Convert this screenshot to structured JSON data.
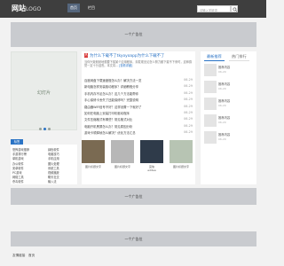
{
  "header": {
    "logo_main": "网站",
    "logo_sub": "LOGO",
    "nav": [
      {
        "label": "首页",
        "active": true
      },
      {
        "label": "栏目",
        "active": false
      }
    ],
    "search_placeholder": "请输入关键词"
  },
  "ads": {
    "top": "一个广告位",
    "middle": "一个广告位",
    "bottom": "一个广告位"
  },
  "slideshow": {
    "label": "幻灯片",
    "total": 3,
    "active_index": 1
  },
  "news": {
    "badge": "热",
    "headline": "为什么下载不了tkyoyoapp为什么下载不了",
    "summary": "当你兴致勃勃地想要下载某个应用程序，却发现无论怎么努力都下载不下来时，这种感觉一定十分沮丧。本文将...",
    "summary_more": "[查看详细]",
    "items": [
      {
        "title": "百度网盘下载速度慢怎么办？解决方法一览",
        "date": "06-29"
      },
      {
        "title": "新电脑怎样安装驱动程序？详细教程分享",
        "date": "06-29"
      },
      {
        "title": "手机内存不足怎么办？这几个方法能帮你",
        "date": "06-29"
      },
      {
        "title": "手心保修卡丢失了还能保修吗？完整说明",
        "date": "06-29"
      },
      {
        "title": "路由器WiFi信号不好？这样设置一下就好了",
        "date": "06-29"
      },
      {
        "title": "如何在电脑上安装打印机驱动程序",
        "date": "06-29"
      },
      {
        "title": "文件压缩格式有哪些？常见格式对比",
        "date": "06-29"
      },
      {
        "title": "电脑开机黑屏怎么办？常见原因分析",
        "date": "06-29"
      },
      {
        "title": "游戏卡顿掉帧怎么解决？优化方法汇总",
        "date": "06-29"
      }
    ]
  },
  "side": {
    "tabs": [
      "最新推荐",
      "热门排行"
    ],
    "items": [
      {
        "title": "推荐内容",
        "meta": "06-29"
      },
      {
        "title": "推荐内容",
        "meta": "06-29"
      },
      {
        "title": "推荐内容",
        "meta": "06-29"
      },
      {
        "title": "推荐内容",
        "meta": "06-29"
      },
      {
        "title": "推荐内容",
        "meta": "06-29"
      }
    ]
  },
  "tags": {
    "label": "标签",
    "rows": [
      [
        "恐怖游戏推荐",
        "绿色软件"
      ],
      [
        "手游排行榜",
        "电脑技巧"
      ],
      [
        "单机游戏",
        "手机应用"
      ],
      [
        "办公软件",
        "图片处理"
      ],
      [
        "安卓软件",
        "系统工具"
      ],
      [
        "PC游戏",
        "视频播放"
      ],
      [
        "网络工具",
        "聊天社交"
      ],
      [
        "杀毒软件",
        "输入法"
      ]
    ]
  },
  "tiles": [
    {
      "caption": "图片标题文字",
      "caption2": "",
      "color": "#7a6a52"
    },
    {
      "caption": "图片标题文字",
      "caption2": "",
      "color": "#b7b7b7"
    },
    {
      "caption": "宜信",
      "caption2": "editea",
      "color": "#2f3b4a"
    },
    {
      "caption": "图片标题文字",
      "caption2": "",
      "color": "#b7c4b3"
    }
  ],
  "footer": {
    "links": [
      "友情链接",
      "首页"
    ]
  }
}
